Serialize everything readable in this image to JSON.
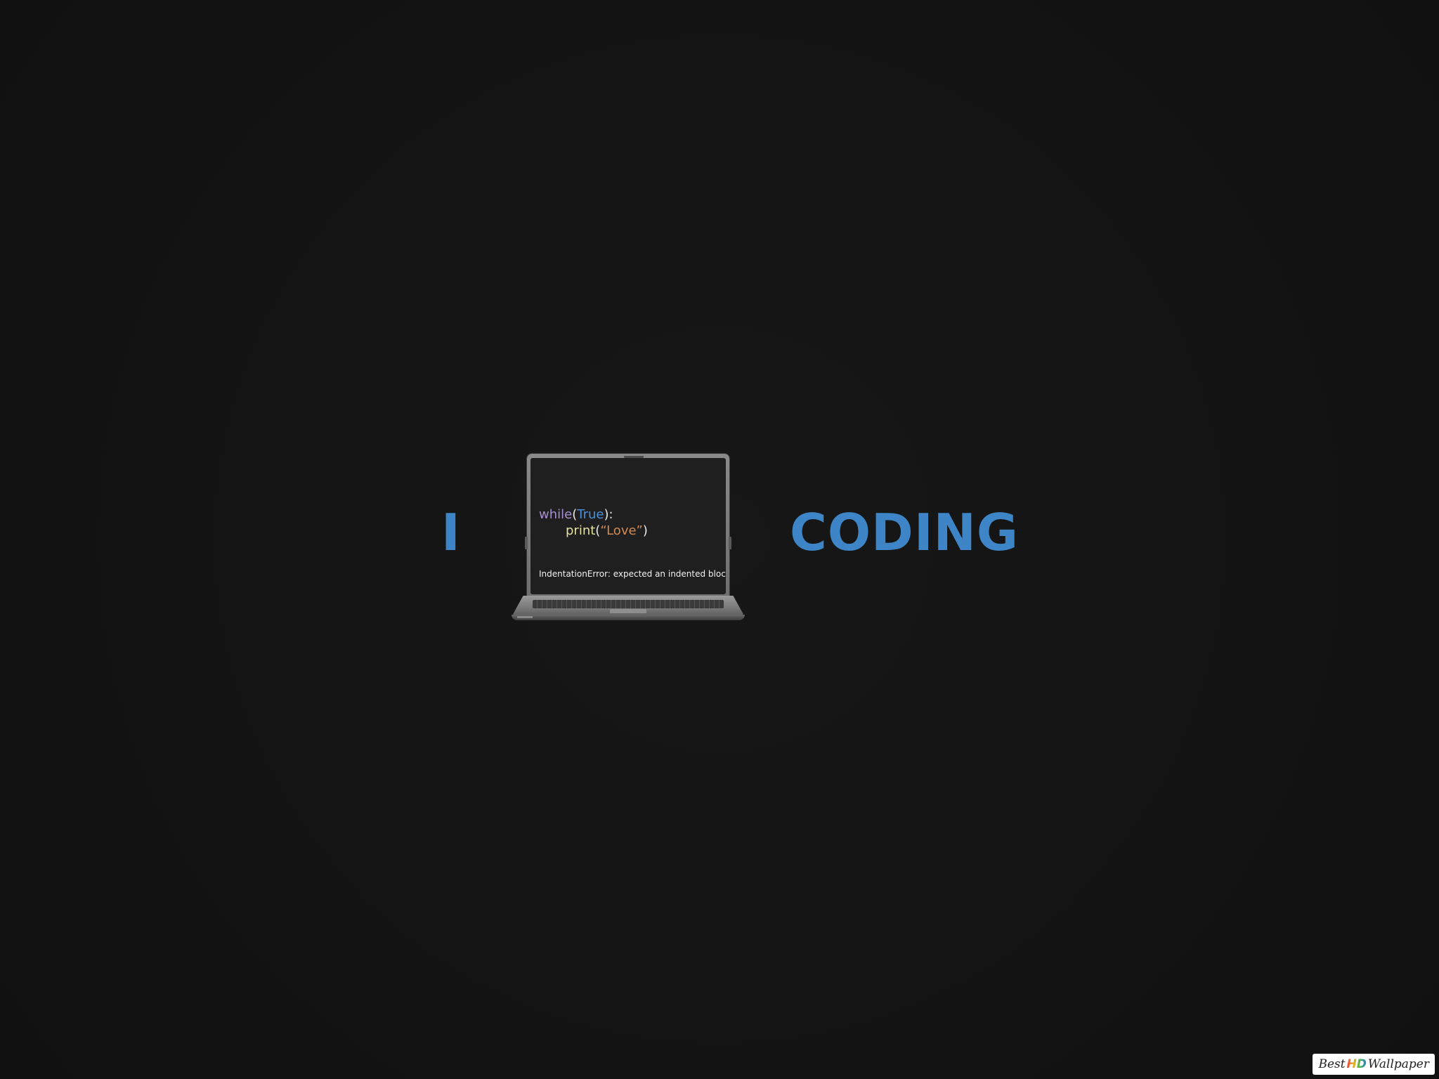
{
  "headline": {
    "subject": "I",
    "object": "CODING",
    "color": "#3d85c6"
  },
  "laptop": {
    "code_line_1": {
      "keyword": "while",
      "open_paren": "(",
      "value": "True",
      "close": "):"
    },
    "code_line_2": {
      "function": "print",
      "open_paren": "(",
      "string": "“Love”",
      "close_paren": ")"
    },
    "error_message": "IndentationError: expected an indented block",
    "colors": {
      "keyword": "#a88fd1",
      "value": "#4a90d9",
      "punctuation": "#e8e8e8",
      "function": "#e4e0a0",
      "string": "#d08a55",
      "error": "#f2f2f2"
    }
  },
  "watermark": {
    "prefix": "Best",
    "hd": "HD",
    "suffix": "Wallpaper"
  }
}
